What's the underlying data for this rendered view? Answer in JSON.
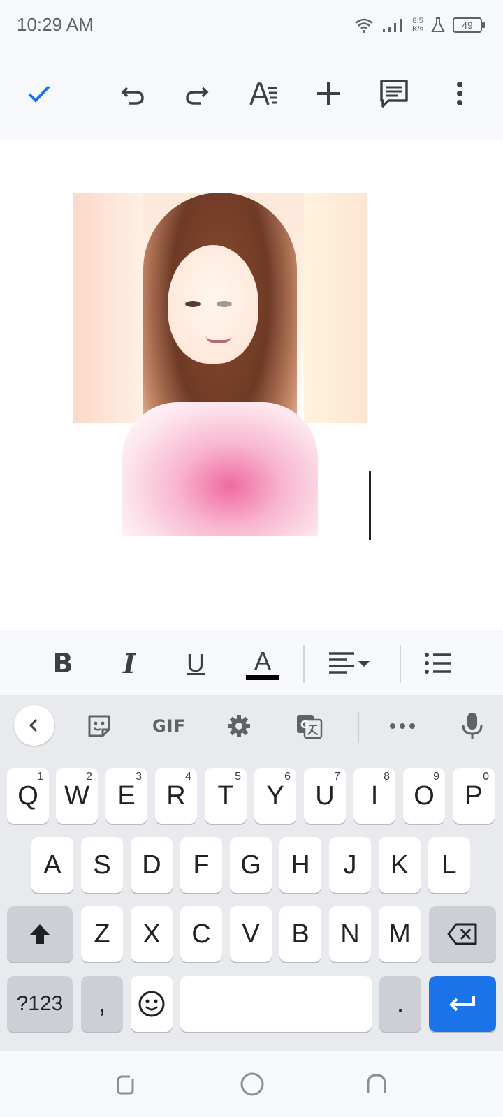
{
  "status_bar": {
    "time": "10:29 AM",
    "net_speed_value": "8.5",
    "net_speed_unit": "K/s",
    "battery": "49"
  },
  "toolbar": {
    "icons": [
      "check-icon",
      "undo-icon",
      "redo-icon",
      "text-format-icon",
      "insert-icon",
      "comment-icon",
      "more-vert-icon"
    ]
  },
  "format_bar": {
    "bold": "B",
    "italic": "I",
    "underline": "U",
    "text_color": "A",
    "text_color_hex": "#000000"
  },
  "keyboard": {
    "row1": [
      {
        "key": "Q",
        "hint": "1"
      },
      {
        "key": "W",
        "hint": "2"
      },
      {
        "key": "E",
        "hint": "3"
      },
      {
        "key": "R",
        "hint": "4"
      },
      {
        "key": "T",
        "hint": "5"
      },
      {
        "key": "Y",
        "hint": "6"
      },
      {
        "key": "U",
        "hint": "7"
      },
      {
        "key": "I",
        "hint": "8"
      },
      {
        "key": "O",
        "hint": "9"
      },
      {
        "key": "P",
        "hint": "0"
      }
    ],
    "row2": [
      "A",
      "S",
      "D",
      "F",
      "G",
      "H",
      "J",
      "K",
      "L"
    ],
    "row3": [
      "Z",
      "X",
      "C",
      "V",
      "B",
      "N",
      "M"
    ],
    "symbols_label": "?123",
    "comma": ",",
    "period": ".",
    "gif_label": "GIF",
    "accent_color": "#1a73e8"
  }
}
